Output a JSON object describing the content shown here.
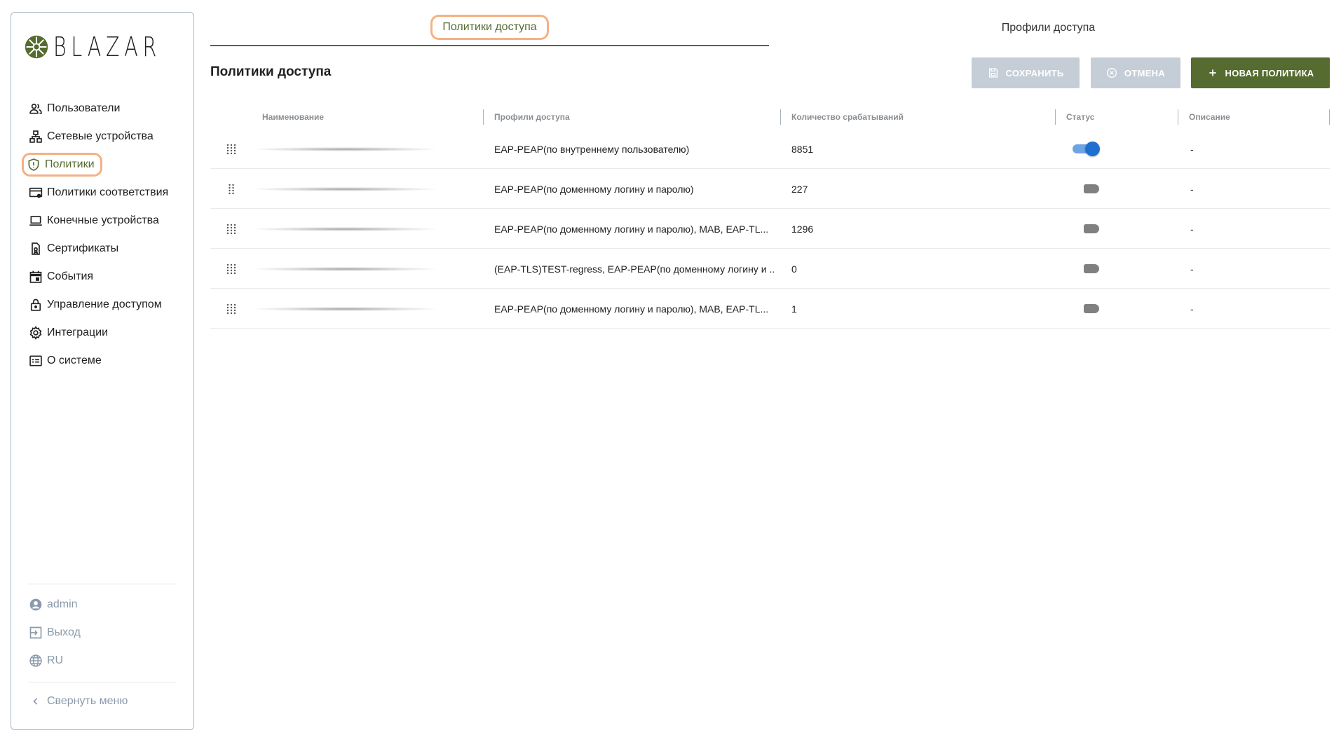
{
  "brand": {
    "name": "BLAZAR"
  },
  "sidebar": {
    "items": [
      {
        "label": "Пользователи",
        "icon": "users-icon"
      },
      {
        "label": "Сетевые устройства",
        "icon": "network-icon"
      },
      {
        "label": "Политики",
        "icon": "shield-icon",
        "active": true
      },
      {
        "label": "Политики соответствия",
        "icon": "card-settings-icon"
      },
      {
        "label": "Конечные устройства",
        "icon": "laptop-icon"
      },
      {
        "label": "Сертификаты",
        "icon": "certificate-icon"
      },
      {
        "label": "События",
        "icon": "calendar-icon"
      },
      {
        "label": "Управление доступом",
        "icon": "lock-icon"
      },
      {
        "label": "Интеграции",
        "icon": "gear-icon"
      },
      {
        "label": "О системе",
        "icon": "info-card-icon"
      }
    ],
    "user": "admin",
    "logout": "Выход",
    "language": "RU",
    "collapse": "Свернуть меню"
  },
  "tabs": [
    {
      "label": "Политики доступа",
      "active": true
    },
    {
      "label": "Профили доступа",
      "active": false
    }
  ],
  "page": {
    "title": "Политики доступа"
  },
  "toolbar": {
    "save_label": "СОХРАНИТЬ",
    "cancel_label": "ОТМЕНА",
    "new_label": "НОВАЯ ПОЛИТИКА"
  },
  "table": {
    "columns": [
      "Наименование",
      "Профили доступа",
      "Количество срабатываний",
      "Статус",
      "Описание"
    ],
    "rows": [
      {
        "profiles": "EAP-PEAP(по внутреннему пользователю)",
        "count": "8851",
        "enabled": true,
        "description": "-"
      },
      {
        "profiles": "EAP-PEAP(по доменному логину и паролю)",
        "count": "227",
        "enabled": false,
        "description": "-"
      },
      {
        "profiles": "EAP-PEAP(по доменному логину и паролю), MAB, EAP-TL...",
        "count": "1296",
        "enabled": false,
        "description": "-"
      },
      {
        "profiles": "(EAP-TLS)TEST-regress, EAP-PEAP(по доменному логину и ...",
        "count": "0",
        "enabled": false,
        "description": "-"
      },
      {
        "profiles": "ЕAP-PEAP(по доменному логину и паролю), MAB, EAP-TL...",
        "count": "1",
        "enabled": false,
        "description": "-"
      }
    ]
  },
  "colors": {
    "accent": "#556b2f",
    "highlight": "#f4b183",
    "toggle_on": "#1e6fd0",
    "disabled_button": "#c5ced6"
  }
}
